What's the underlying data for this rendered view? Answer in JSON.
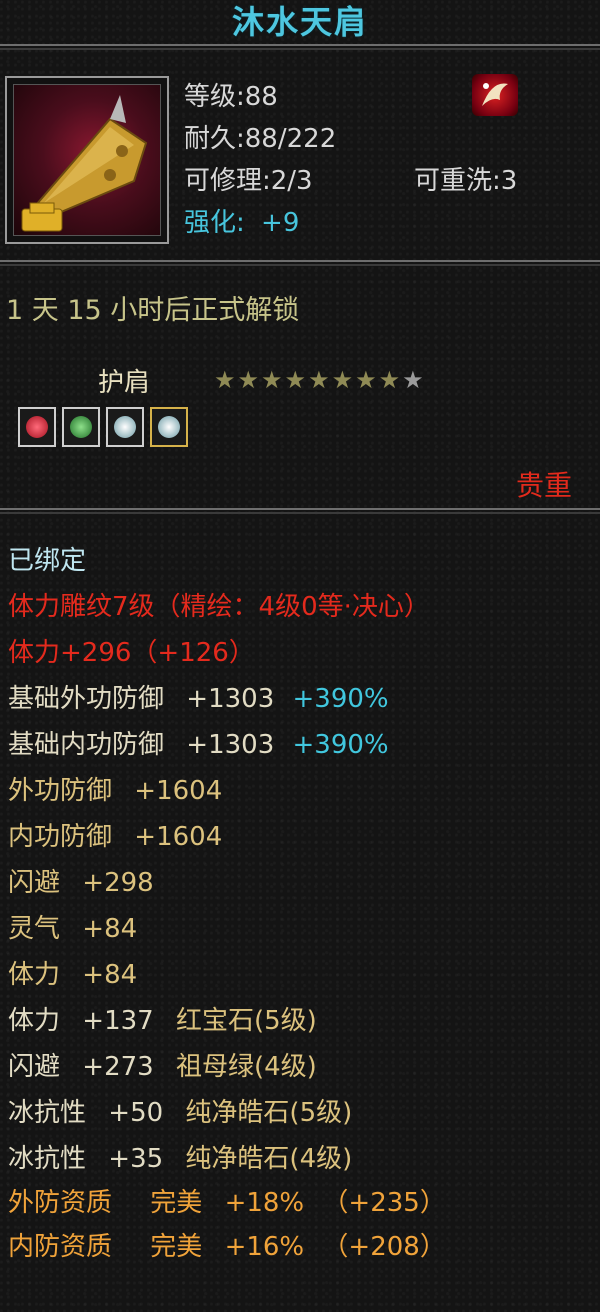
{
  "item": {
    "name": "沐水天肩",
    "level": "等级:88",
    "durability": "耐久:88/222",
    "repairable": "可修理:2/3",
    "rewash": "可重洗:3",
    "enhance_label": "强化:",
    "enhance_value": "+9"
  },
  "unlock_text": "1 天 15 小时后正式解锁",
  "slot_type": "护肩",
  "stars": {
    "filled": 8,
    "total": 9
  },
  "gems": [
    {
      "name": "red-gem-icon",
      "color": "#d8283a"
    },
    {
      "name": "green-gem-icon",
      "color": "#2f9a3a"
    },
    {
      "name": "white-gem-icon",
      "color": "#cfe6ea"
    },
    {
      "name": "white-gem-icon",
      "color": "#cfe6ea"
    }
  ],
  "precious": "贵重",
  "bound": "已绑定",
  "carving": "体力雕纹7级（精绘：4级0等·决心）",
  "stats": {
    "stamina_carve": {
      "label": "体力+296（+126）"
    },
    "base_outer_def": {
      "label": "基础外功防御",
      "value": "+1303",
      "pct": "+390%"
    },
    "base_inner_def": {
      "label": "基础内功防御",
      "value": "+1303",
      "pct": "+390%"
    },
    "outer_def": {
      "label": "外功防御",
      "value": "+1604"
    },
    "inner_def": {
      "label": "内功防御",
      "value": "+1604"
    },
    "dodge": {
      "label": "闪避",
      "value": "+298"
    },
    "spirit": {
      "label": "灵气",
      "value": "+84"
    },
    "stamina": {
      "label": "体力",
      "value": "+84"
    },
    "gem1": {
      "label": "体力",
      "value": "+137",
      "gem": "红宝石(5级)"
    },
    "gem2": {
      "label": "闪避",
      "value": "+273",
      "gem": "祖母绿(4级)"
    },
    "gem3": {
      "label": "冰抗性",
      "value": "+50",
      "gem": "纯净皓石(5级)"
    },
    "gem4": {
      "label": "冰抗性",
      "value": "+35",
      "gem": "纯净皓石(4级)"
    },
    "quality_outer": {
      "label": "外防资质",
      "grade": "完美",
      "value": "+18%",
      "extra": "（+235）"
    },
    "quality_inner": {
      "label": "内防资质",
      "grade": "完美",
      "value": "+16%",
      "extra": "（+208）"
    }
  },
  "colors": {
    "title": "#4ec7e0",
    "red": "#e42a1d",
    "gold": "#dcc27e",
    "orange": "#f0a33a",
    "cyan": "#41c7de"
  }
}
